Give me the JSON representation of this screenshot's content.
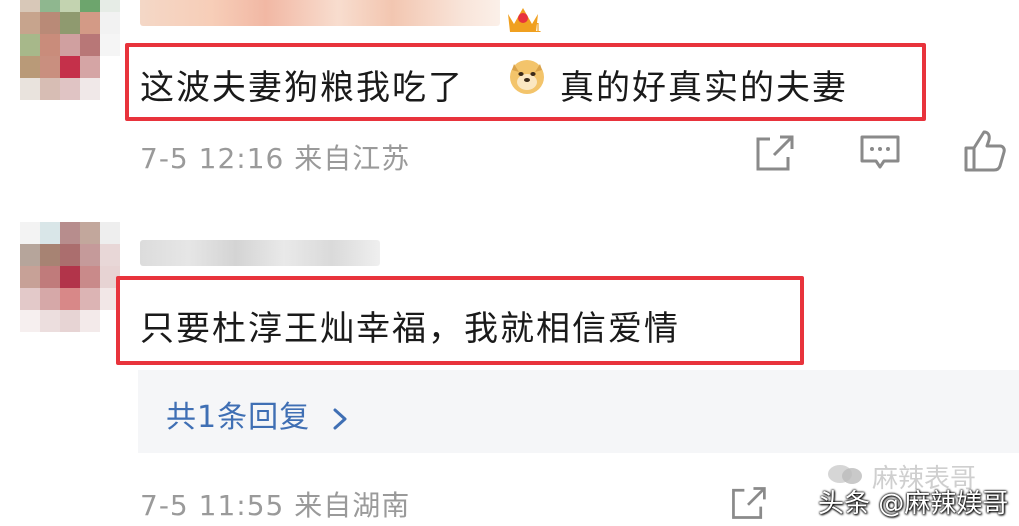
{
  "comments": [
    {
      "text_before": "这波夫妻狗粮我吃了",
      "emoji_icon": "doge-emoji-icon",
      "text_after": "真的好真实的夫妻",
      "date": "7-5 12:16",
      "location": "来自江苏"
    },
    {
      "text": "只要杜淳王灿幸福，我就相信爱情",
      "reply_link": "共1条回复",
      "date": "7-5 11:55",
      "location": "来自湖南"
    }
  ],
  "watermark": {
    "text": "头条 @麻辣媄哥",
    "faded_text": "麻辣表哥"
  },
  "colors": {
    "highlight_border": "#e8333c",
    "meta_text": "#9a9a9a",
    "reply_link": "#3f6fb4",
    "reply_panel_bg": "#f5f6f8"
  }
}
